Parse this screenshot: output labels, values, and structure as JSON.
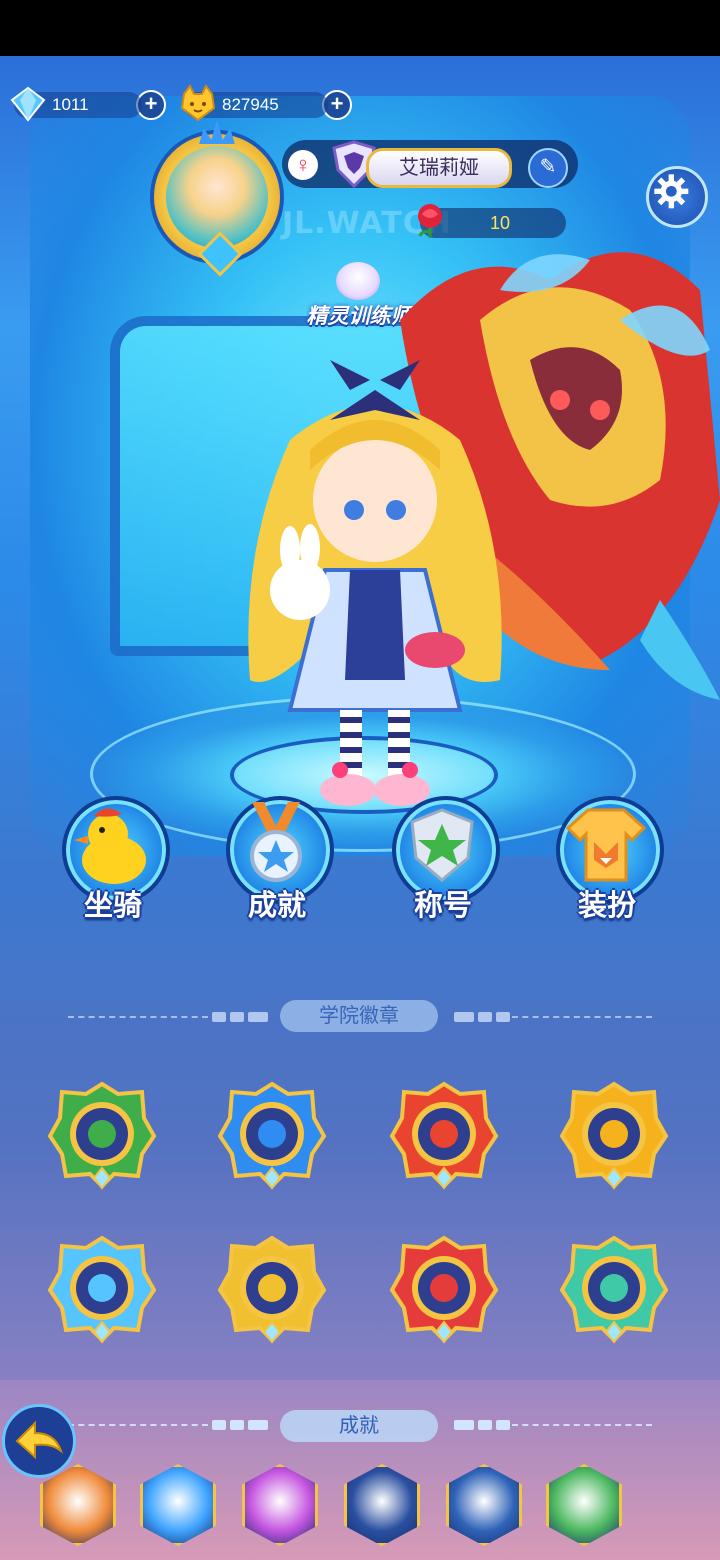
{
  "currencies": [
    {
      "name": "diamond",
      "value": "1011",
      "icon": "diamond-icon",
      "color": "#58c7ff"
    },
    {
      "name": "cat-coin",
      "value": "827945",
      "icon": "cat-coin-icon",
      "color": "#ffc62e"
    }
  ],
  "profile": {
    "player_name": "艾瑞莉娅",
    "gender_symbol": "♀",
    "rose_count": "10",
    "watermark": "JL.WATCH",
    "title_badge": "精灵训练师"
  },
  "actions": [
    {
      "label": "坐骑",
      "icon": "duck-mount-icon"
    },
    {
      "label": "成就",
      "icon": "medal-icon"
    },
    {
      "label": "称号",
      "icon": "star-title-icon"
    },
    {
      "label": "装扮",
      "icon": "fox-shirt-icon"
    }
  ],
  "sections": {
    "academy_badges": "学院徽章",
    "achievements": "成就"
  },
  "badges": [
    {
      "icon": "leaf-badge-icon",
      "color": "#3fae4a"
    },
    {
      "icon": "water-badge-icon",
      "color": "#2f8cf0"
    },
    {
      "icon": "fire-badge-icon",
      "color": "#e8442f"
    },
    {
      "icon": "light-badge-icon",
      "color": "#f5b21d"
    },
    {
      "icon": "ice-badge-icon",
      "color": "#55c4ff"
    },
    {
      "icon": "electric-badge-icon",
      "color": "#f0c030"
    },
    {
      "icon": "flame-badge-icon",
      "color": "#e63b3b"
    },
    {
      "icon": "wind-badge-icon",
      "color": "#3fc9a7"
    }
  ],
  "achievement_icons": [
    {
      "icon": "fox-achievement-icon",
      "color": "#f08a3a"
    },
    {
      "icon": "star-achievement-icon",
      "color": "#3fa4ff"
    },
    {
      "icon": "dice-achievement-icon",
      "color": "#c455e0"
    },
    {
      "icon": "bear-achievement-icon",
      "color": "#2a4fa0"
    },
    {
      "icon": "monkey-achievement-icon",
      "color": "#2f63b8"
    },
    {
      "icon": "cat-achievement-icon",
      "color": "#4cb860"
    }
  ],
  "colors": {
    "accent_gold": "#f4c442",
    "accent_blue": "#1c4d9d",
    "rose_count_color": "#ffe35a"
  }
}
